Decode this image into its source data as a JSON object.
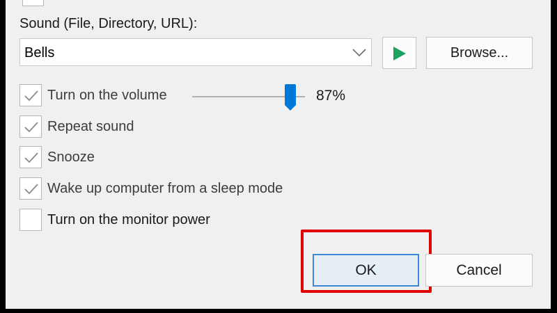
{
  "sound": {
    "label": "Sound (File, Directory, URL):",
    "selected": "Bells",
    "browse_label": "Browse..."
  },
  "options": [
    {
      "label": "Turn on the volume",
      "checked": true
    },
    {
      "label": "Repeat sound",
      "checked": true
    },
    {
      "label": "Snooze",
      "checked": true
    },
    {
      "label": "Wake up computer from a sleep mode",
      "checked": true
    },
    {
      "label": "Turn on the monitor power",
      "checked": false
    }
  ],
  "volume": {
    "value": 0.87,
    "display": "87%"
  },
  "buttons": {
    "ok_label": "OK",
    "cancel_label": "Cancel"
  },
  "colors": {
    "play_icon": "#1aa260",
    "slider_thumb": "#0078d7",
    "highlight": "#e00000",
    "ok_border": "#3b89d6"
  },
  "icons": {
    "combo_arrow": "chevron-down-icon",
    "play": "play-icon",
    "check": "checkmark-icon"
  }
}
